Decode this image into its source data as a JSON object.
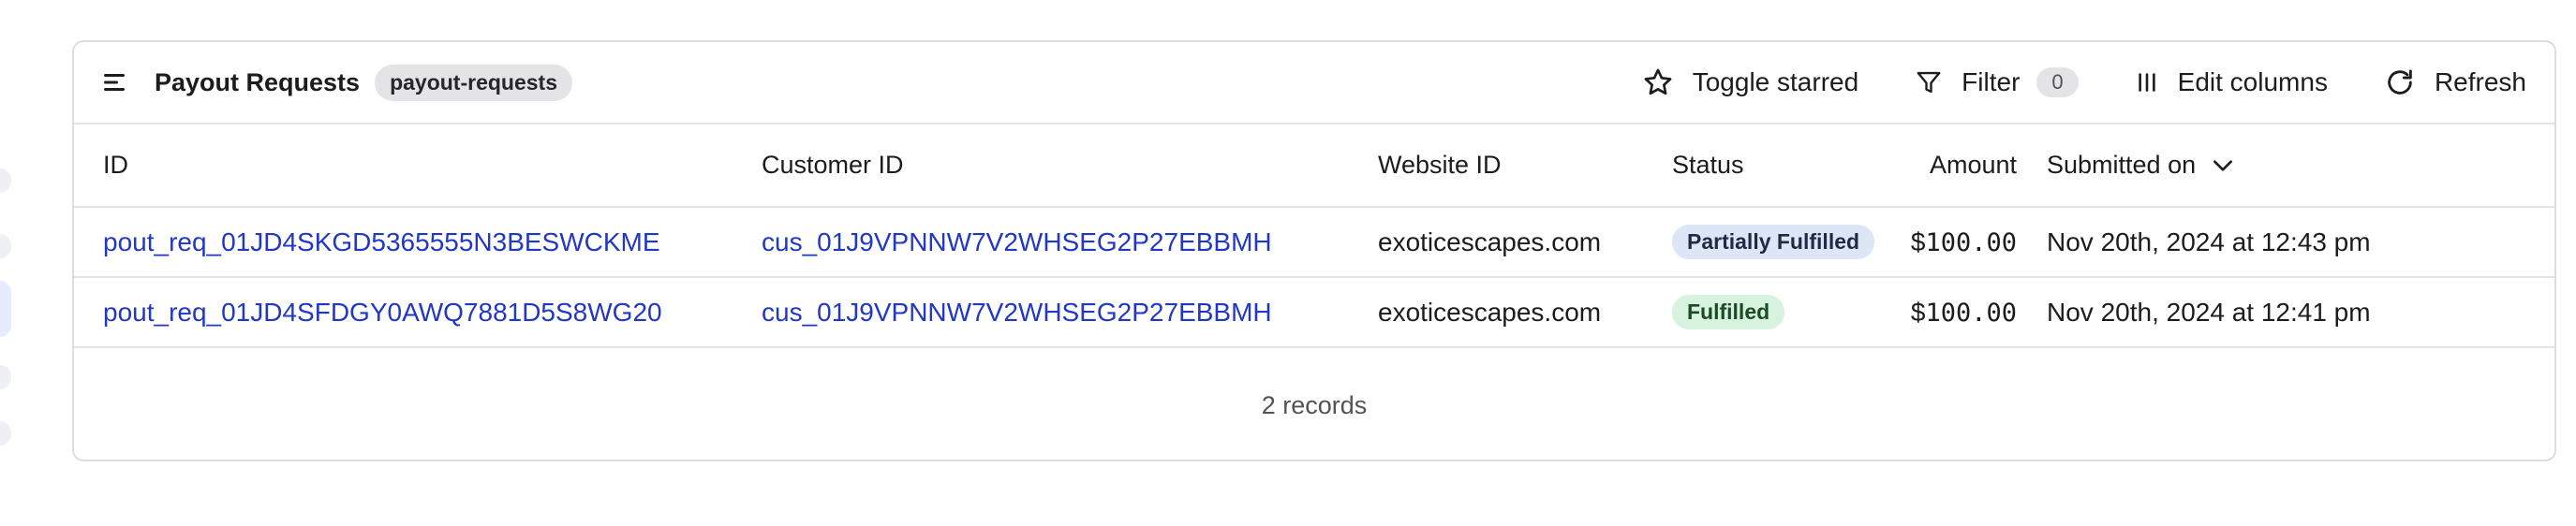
{
  "toolbar": {
    "title": "Payout Requests",
    "slug": "payout-requests",
    "toggle_starred_label": "Toggle starred",
    "filter_label": "Filter",
    "filter_count": "0",
    "edit_columns_label": "Edit columns",
    "refresh_label": "Refresh"
  },
  "table": {
    "columns": {
      "id": "ID",
      "customer_id": "Customer ID",
      "website_id": "Website ID",
      "status": "Status",
      "amount": "Amount",
      "submitted_on": "Submitted on"
    },
    "rows": [
      {
        "id": "pout_req_01JD4SKGD5365555N3BESWCKME",
        "customer_id": "cus_01J9VPNNW7V2WHSEG2P27EBBMH",
        "website_id": "exoticescapes.com",
        "status": "Partially Fulfilled",
        "amount_symbol": "$",
        "amount_value": "100.00",
        "submitted_on": "Nov 20th, 2024 at 12:43 pm"
      },
      {
        "id": "pout_req_01JD4SFDGY0AWQ7881D5S8WG20",
        "customer_id": "cus_01J9VPNNW7V2WHSEG2P27EBBMH",
        "website_id": "exoticescapes.com",
        "status": "Fulfilled",
        "amount_symbol": "$",
        "amount_value": "100.00",
        "submitted_on": "Nov 20th, 2024 at 12:41 pm"
      }
    ],
    "footer_count": "2 records"
  },
  "icons": {
    "menu": "menu-lines-icon",
    "star": "star-icon",
    "filter": "filter-funnel-icon",
    "columns": "columns-icon",
    "refresh": "refresh-icon",
    "sort": "chevron-down-icon"
  },
  "colors": {
    "link": "#2137c6",
    "partial_bg": "#dde6f7",
    "fulfilled_bg": "#d7f2de",
    "border": "#dcdde1"
  }
}
